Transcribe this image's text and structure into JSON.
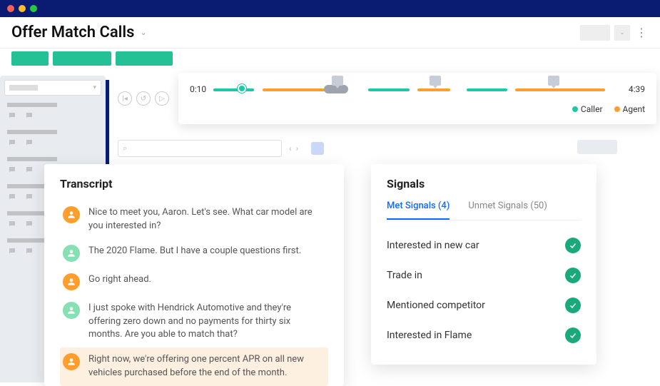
{
  "header": {
    "title": "Offer Match Calls"
  },
  "timeline": {
    "start_time": "0:10",
    "end_time": "4:39",
    "legend": {
      "caller": "Caller",
      "agent": "Agent"
    }
  },
  "transcript": {
    "title": "Transcript",
    "messages": [
      {
        "speaker": "agent",
        "text": "Nice to meet you, Aaron. Let's see. What car model are you interested in?"
      },
      {
        "speaker": "caller",
        "text": "The 2020 Flame. But I have a couple questions first."
      },
      {
        "speaker": "agent",
        "text": "Go right ahead."
      },
      {
        "speaker": "caller",
        "text": "I just spoke with Hendrick Automotive and they're offering zero down and no payments for thirty six months. Are you able to match that?"
      },
      {
        "speaker": "agent",
        "text": "Right now, we're offering one percent APR on all new vehicles purchased before the end of the month."
      }
    ],
    "highlight_index": 4
  },
  "signals": {
    "title": "Signals",
    "tabs": {
      "met_label": "Met Signals (4)",
      "unmet_label": "Unmet Signals (50)"
    },
    "met": [
      "Interested in new car",
      "Trade in",
      "Mentioned competitor",
      "Interested in Flame"
    ]
  },
  "colors": {
    "caller": "#1cc8a5",
    "agent": "#ff9e2c",
    "brand_blue": "#0a1b72",
    "link_blue": "#0b6bff"
  }
}
